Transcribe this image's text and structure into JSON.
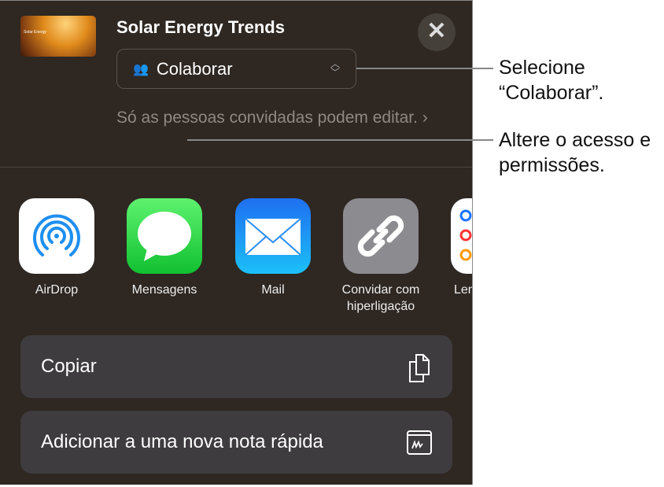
{
  "sheet": {
    "document_title": "Solar Energy Trends",
    "thumbnail_text": "Solar Energy",
    "close_icon": "xmark-icon",
    "collab_select": {
      "value": "Colaborar",
      "icon": "people-icon"
    },
    "access_description": "Só as pessoas convidadas podem editar.",
    "apps": [
      {
        "label": "AirDrop",
        "icon": "airdrop-icon"
      },
      {
        "label": "Mensagens",
        "icon": "messages-icon"
      },
      {
        "label": "Mail",
        "icon": "mail-icon"
      },
      {
        "label": "Convidar com hiperligação",
        "icon": "link-icon"
      },
      {
        "label": "Lembretes",
        "icon": "reminders-icon"
      }
    ],
    "actions": [
      {
        "label": "Copiar",
        "icon": "copy-icon"
      },
      {
        "label": "Adicionar a uma nova nota rápida",
        "icon": "quick-note-icon"
      }
    ]
  },
  "callouts": [
    {
      "text": "Selecione “Colaborar”."
    },
    {
      "text": "Altere o acesso e permissões."
    }
  ]
}
